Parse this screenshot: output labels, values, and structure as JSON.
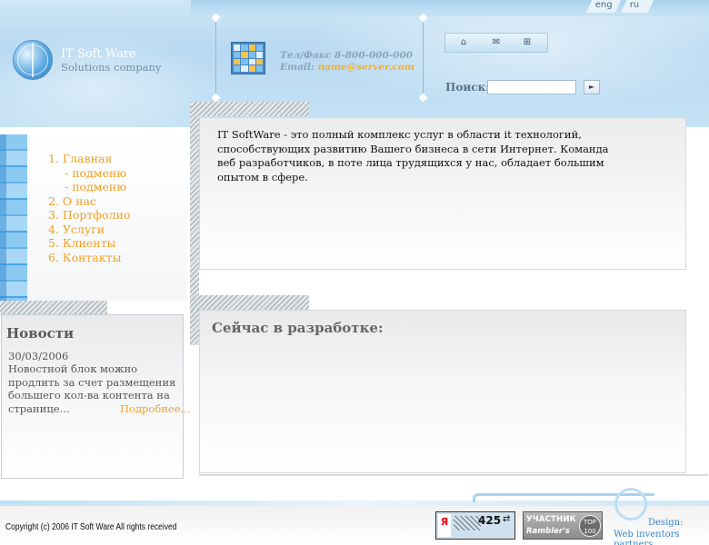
{
  "header": {
    "lang_eng": "eng",
    "lang_ru": "ru",
    "logo_title": "IT Soft Ware",
    "logo_subtitle": "Solutions company",
    "phone": "Тел/Факс 8-800-000-000",
    "email_label": "Email:",
    "email_value": "name@server.com",
    "search_label": "Поиск:",
    "search_value": "",
    "search_button": "►",
    "icons": [
      "home-icon",
      "mail-icon",
      "sitemap-icon"
    ]
  },
  "menu": {
    "items": [
      {
        "label": "1. Главная",
        "sub": false
      },
      {
        "label": "- подменю",
        "sub": true
      },
      {
        "label": "- подменю",
        "sub": true
      },
      {
        "label": "2. О нас",
        "sub": false
      },
      {
        "label": "3. Портфолио",
        "sub": false
      },
      {
        "label": "4. Услуги",
        "sub": false
      },
      {
        "label": "5. Клиенты",
        "sub": false
      },
      {
        "label": "6. Контакты",
        "sub": false
      }
    ]
  },
  "news": {
    "title": "Новости",
    "date": "30/03/2006",
    "text": "Новостной блок можно продлить за счет размещения большего кол-ва контента на странице...",
    "more": "Подробнее..."
  },
  "main": {
    "intro": "IT SoftWare - это полный комплекс услуг в области it технологий, способствующих развитию Вашего бизнеса в сети Интернет. Команда веб разработчиков, в поте лица трудящихся у нас, обладает большим опытом в сфере.",
    "dev_title": "Сейчас в разработке:"
  },
  "footer": {
    "copyright": "Copyright (c) 2006  IT Soft Ware All rights received",
    "yandex_letter": "Я",
    "yandex_count": "425",
    "yandex_arrows": "⇄",
    "rambler_line1": "УЧАСТНИК",
    "rambler_line2": "Rambler's",
    "rambler_top": "TOP 100",
    "design_label": "Design:",
    "design_credit": "Web inventors partners"
  },
  "colors": {
    "menu_link": "#f0a020",
    "header_sky": "#b7d9f1",
    "credit": "#3a86c8"
  }
}
